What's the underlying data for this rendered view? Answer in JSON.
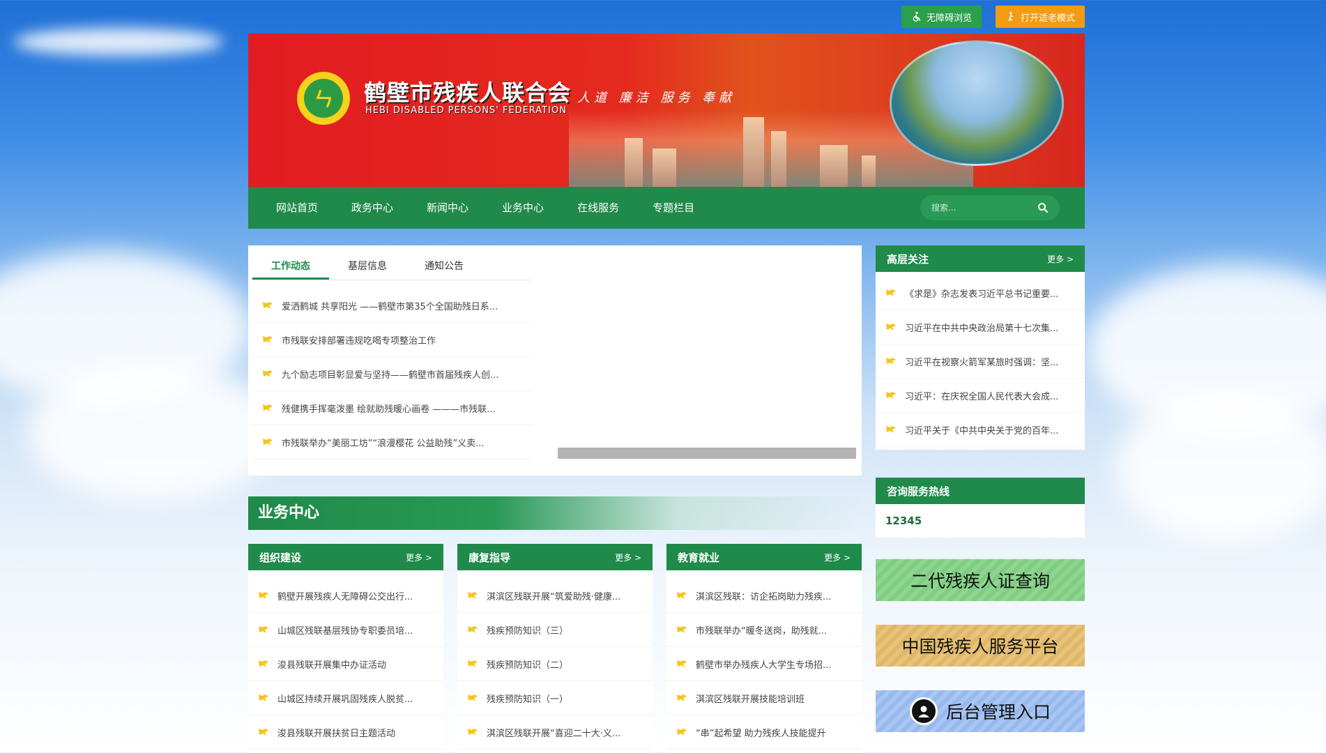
{
  "topbar": {
    "accessible_label": "无障碍浏览",
    "elderly_label": "打开适老模式"
  },
  "header": {
    "org_name": "鹤壁市残疾人联合会",
    "org_name_en": "HEBI DISABLED PERSONS' FEDERATION",
    "motto": "人道  廉洁 服务 奉献"
  },
  "nav": {
    "items": [
      "网站首页",
      "政务中心",
      "新闻中心",
      "业务中心",
      "在线服务",
      "专题栏目"
    ],
    "search_placeholder": "搜索..."
  },
  "news": {
    "tabs": [
      "工作动态",
      "基层信息",
      "通知公告"
    ],
    "items": [
      "爱洒鹤城 共享阳光 ——鹤壁市第35个全国助残日系...",
      "市残联安排部署违规吃喝专项整治工作",
      "九个励志项目彰显爱与坚持——鹤壁市首届残疾人创...",
      "残健携手挥毫泼墨 绘就助残暖心画卷 ———市残联...",
      "市残联举办“美丽工坊”“浪漫樱花 公益助残”义卖..."
    ]
  },
  "focus": {
    "title": "高层关注",
    "more": "更多 >",
    "items": [
      "《求是》杂志发表习近平总书记重要...",
      "习近平在中共中央政治局第十七次集...",
      "习近平在视察火箭军某旅时强调：坚...",
      "习近平：在庆祝全国人民代表大会成...",
      "习近平关于《中共中央关于党的百年..."
    ]
  },
  "hotline": {
    "title": "咨询服务热线",
    "number": "12345"
  },
  "quick_links": {
    "card_query": "二代残疾人证查询",
    "service_platform": "中国残疾人服务平台",
    "admin": "后台管理入口"
  },
  "business": {
    "title": "业务中心",
    "columns": [
      {
        "title": "组织建设",
        "more": "更多 >",
        "items": [
          "鹤壁开展残疾人无障碍公交出行...",
          "山城区残联基层残协专职委员培...",
          "浚县残联开展集中办证活动",
          "山城区持续开展巩固残疾人脱贫...",
          "浚县残联开展扶贫日主题活动"
        ]
      },
      {
        "title": "康复指导",
        "more": "更多 >",
        "items": [
          "淇滨区残联开展“筑爱助残·健康...",
          "残疾预防知识（三）",
          "残疾预防知识（二）",
          "残疾预防知识（一）",
          "淇滨区残联开展“喜迎二十大·义..."
        ]
      },
      {
        "title": "教育就业",
        "more": "更多 >",
        "items": [
          "淇滨区残联：访企拓岗助力残疾...",
          "市残联举办“暖冬送岗，助残就...",
          "鹤壁市举办残疾人大学生专场招...",
          "淇滨区残联开展技能培训班",
          "“串”起希望 助力残疾人技能提升"
        ]
      }
    ]
  },
  "colors": {
    "primary_green": "#1f8a4a",
    "banner_red": "#e21c22",
    "flag_yellow": "#f5c518"
  }
}
